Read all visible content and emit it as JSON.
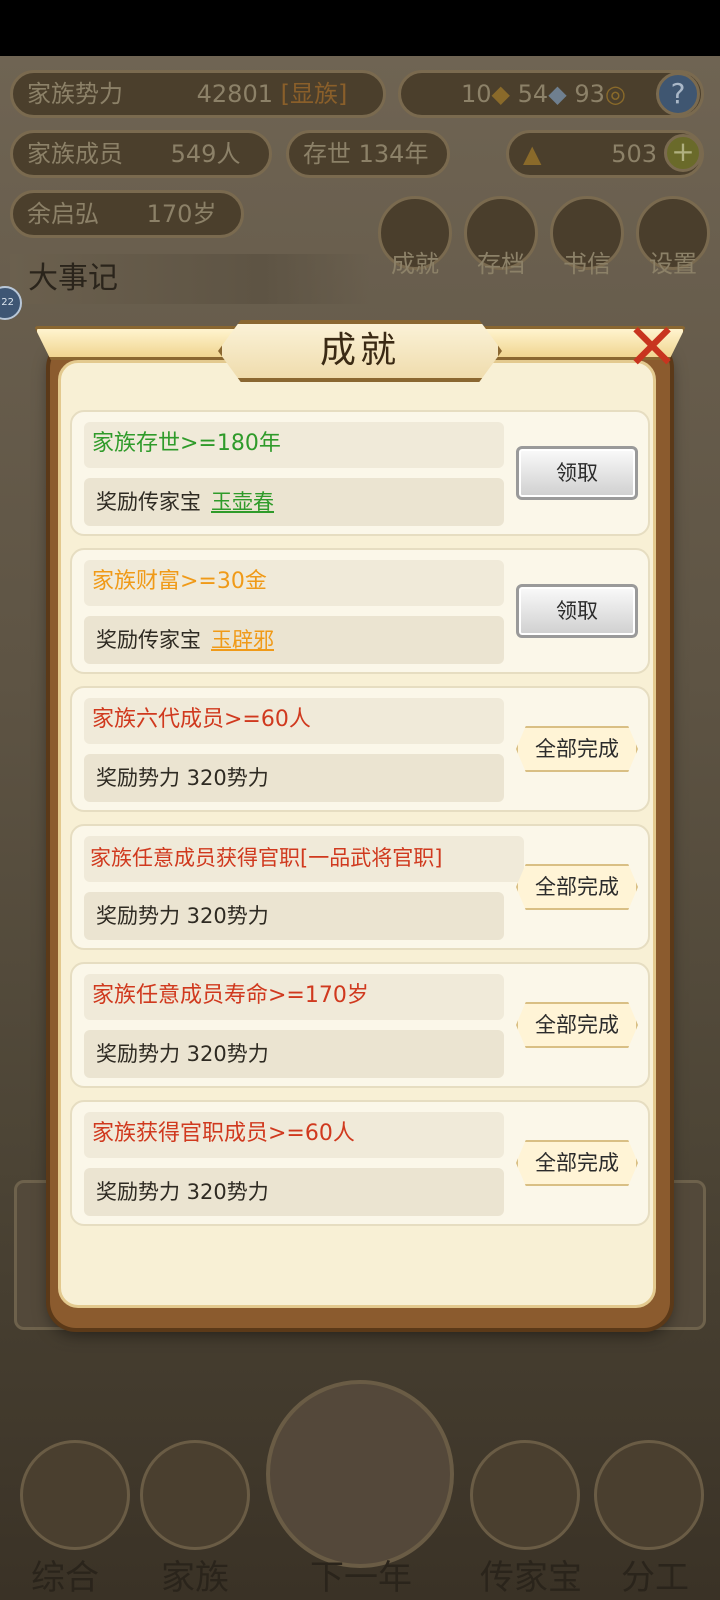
{
  "hud": {
    "power_label": "家族势力",
    "power_value": "42801",
    "power_rank": "[显族]",
    "currency": {
      "gold_bars": "10",
      "silver_bars": "54",
      "coins": "93"
    },
    "members_label": "家族成员",
    "members_value": "549人",
    "existence_label": "存世",
    "existence_value": "134年",
    "ingots_value": "503",
    "patriarch_name": "余启弘",
    "patriarch_age": "170岁",
    "menu": [
      "成就",
      "存档",
      "书信",
      "设置"
    ],
    "chronicle_title": "大事记",
    "side_badge": "22"
  },
  "bottom_nav": [
    "综合",
    "家族",
    "下一年",
    "传家宝",
    "分工"
  ],
  "dialog": {
    "title": "成就",
    "close_icon": "close-x-icon",
    "items": [
      {
        "condition": "家族存世>=180年",
        "reward_prefix": "奖励传家宝",
        "reward_item": "玉壶春",
        "color": "green",
        "action": "领取"
      },
      {
        "condition": "家族财富>=30金",
        "reward_prefix": "奖励传家宝",
        "reward_item": "玉辟邪",
        "color": "orange",
        "action": "领取"
      },
      {
        "condition": "家族六代成员>=60人",
        "reward_prefix": "奖励势力 320势力",
        "reward_item": "",
        "color": "red",
        "action": "全部完成"
      },
      {
        "condition": "家族任意成员获得官职[一品武将官职]",
        "reward_prefix": "奖励势力 320势力",
        "reward_item": "",
        "color": "red",
        "action": "全部完成"
      },
      {
        "condition": "家族任意成员寿命>=170岁",
        "reward_prefix": "奖励势力 320势力",
        "reward_item": "",
        "color": "red",
        "action": "全部完成"
      },
      {
        "condition": "家族获得官职成员>=60人",
        "reward_prefix": "奖励势力 320势力",
        "reward_item": "",
        "color": "red",
        "action": "全部完成"
      }
    ]
  }
}
